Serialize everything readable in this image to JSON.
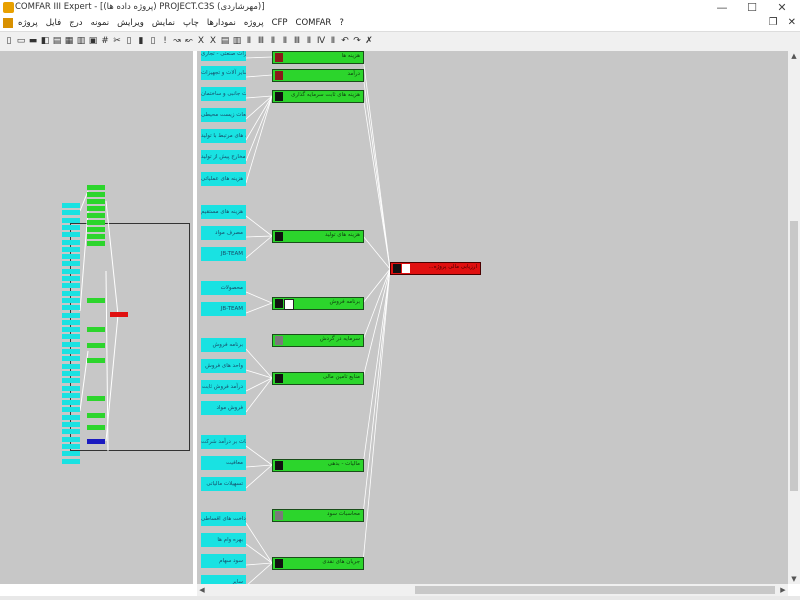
{
  "window": {
    "title": "COMFAR III Expert - [(پروژه داده ها) PROJECT.C3S (مهرشاردی)]",
    "minimize_glyph": "—",
    "maximize_glyph": "☐",
    "close_glyph": "✕"
  },
  "menu": {
    "items": [
      "پروژه",
      "فایل",
      "درج",
      "نمونه",
      "ویرایش",
      "نمایش",
      "چاپ",
      "نمودارها",
      "پروژه",
      "CFP",
      "COMFAR",
      "?"
    ],
    "restore_glyph": "❐",
    "close_glyph": "✕"
  },
  "toolbar": {
    "buttons": [
      "▯",
      "▭",
      "▬",
      "◧",
      "▤",
      "▦",
      "▥",
      "▣",
      "#",
      "✂",
      "▯",
      "▮",
      "▯",
      "!",
      "↝",
      "↜",
      "Ⅹ",
      "Ⅹ",
      "▤",
      "▥",
      "Ⅱ",
      "Ⅲ",
      "Ⅱ",
      "Ⅱ",
      "Ⅲ",
      "Ⅱ",
      "Ⅳ",
      "Ⅱ",
      "↶",
      "↷",
      "✗"
    ]
  },
  "diagram": {
    "root": {
      "label": "...ارزیابی مالی پروژه"
    },
    "green_nodes": [
      {
        "label": "هزینه ها",
        "icon": "red"
      },
      {
        "label": "درآمد",
        "icon": "red"
      },
      {
        "label": "هزینه های ثابت سرمایه گذاری",
        "icon": "black"
      },
      {
        "label": "هزینه های تولید",
        "icon": "black"
      },
      {
        "label": "برنامه فروش",
        "icon": "black-white"
      },
      {
        "label": "سرمایه در گردش",
        "icon": "table"
      },
      {
        "label": "منابع تامین مالی",
        "icon": "black"
      },
      {
        "label": "مالیات - بدهی",
        "icon": "black"
      },
      {
        "label": "محاسبات سود",
        "icon": "table"
      },
      {
        "label": "جریان های نقدی",
        "icon": "black"
      }
    ],
    "cyan_nodes": [
      "تجهیزات صنعتی - تجاری",
      "سایر آلات و تجهیزات",
      "تجهیزات جانبی و ساختمان",
      "مطالعات زیست محیطی",
      "هزینه های مرتبط با تولید",
      "مخارج پیش از تولید",
      "هزینه های عملیاتی",
      "هزینه های مستقیم",
      "مصرف مواد",
      "JB-TEAM",
      "محصولات",
      "JB-TEAM",
      "برنامه فروش",
      "واحد های فروش",
      "درآمد فروش ثابت",
      "فروش مواد",
      "مالیات بر درآمد شرکت",
      "معافیت",
      "تسهیلات مالیاتی",
      "پرداخت های اقساطی",
      "بهره وام ها",
      "سود سهام",
      "سایر"
    ]
  },
  "colors": {
    "workspace": "#c7c7c7",
    "node_cyan": "#19e2e2",
    "node_green": "#2cd52c",
    "node_red": "#e01010",
    "node_blue": "#1a1ac0",
    "connector": "#ffffff"
  }
}
